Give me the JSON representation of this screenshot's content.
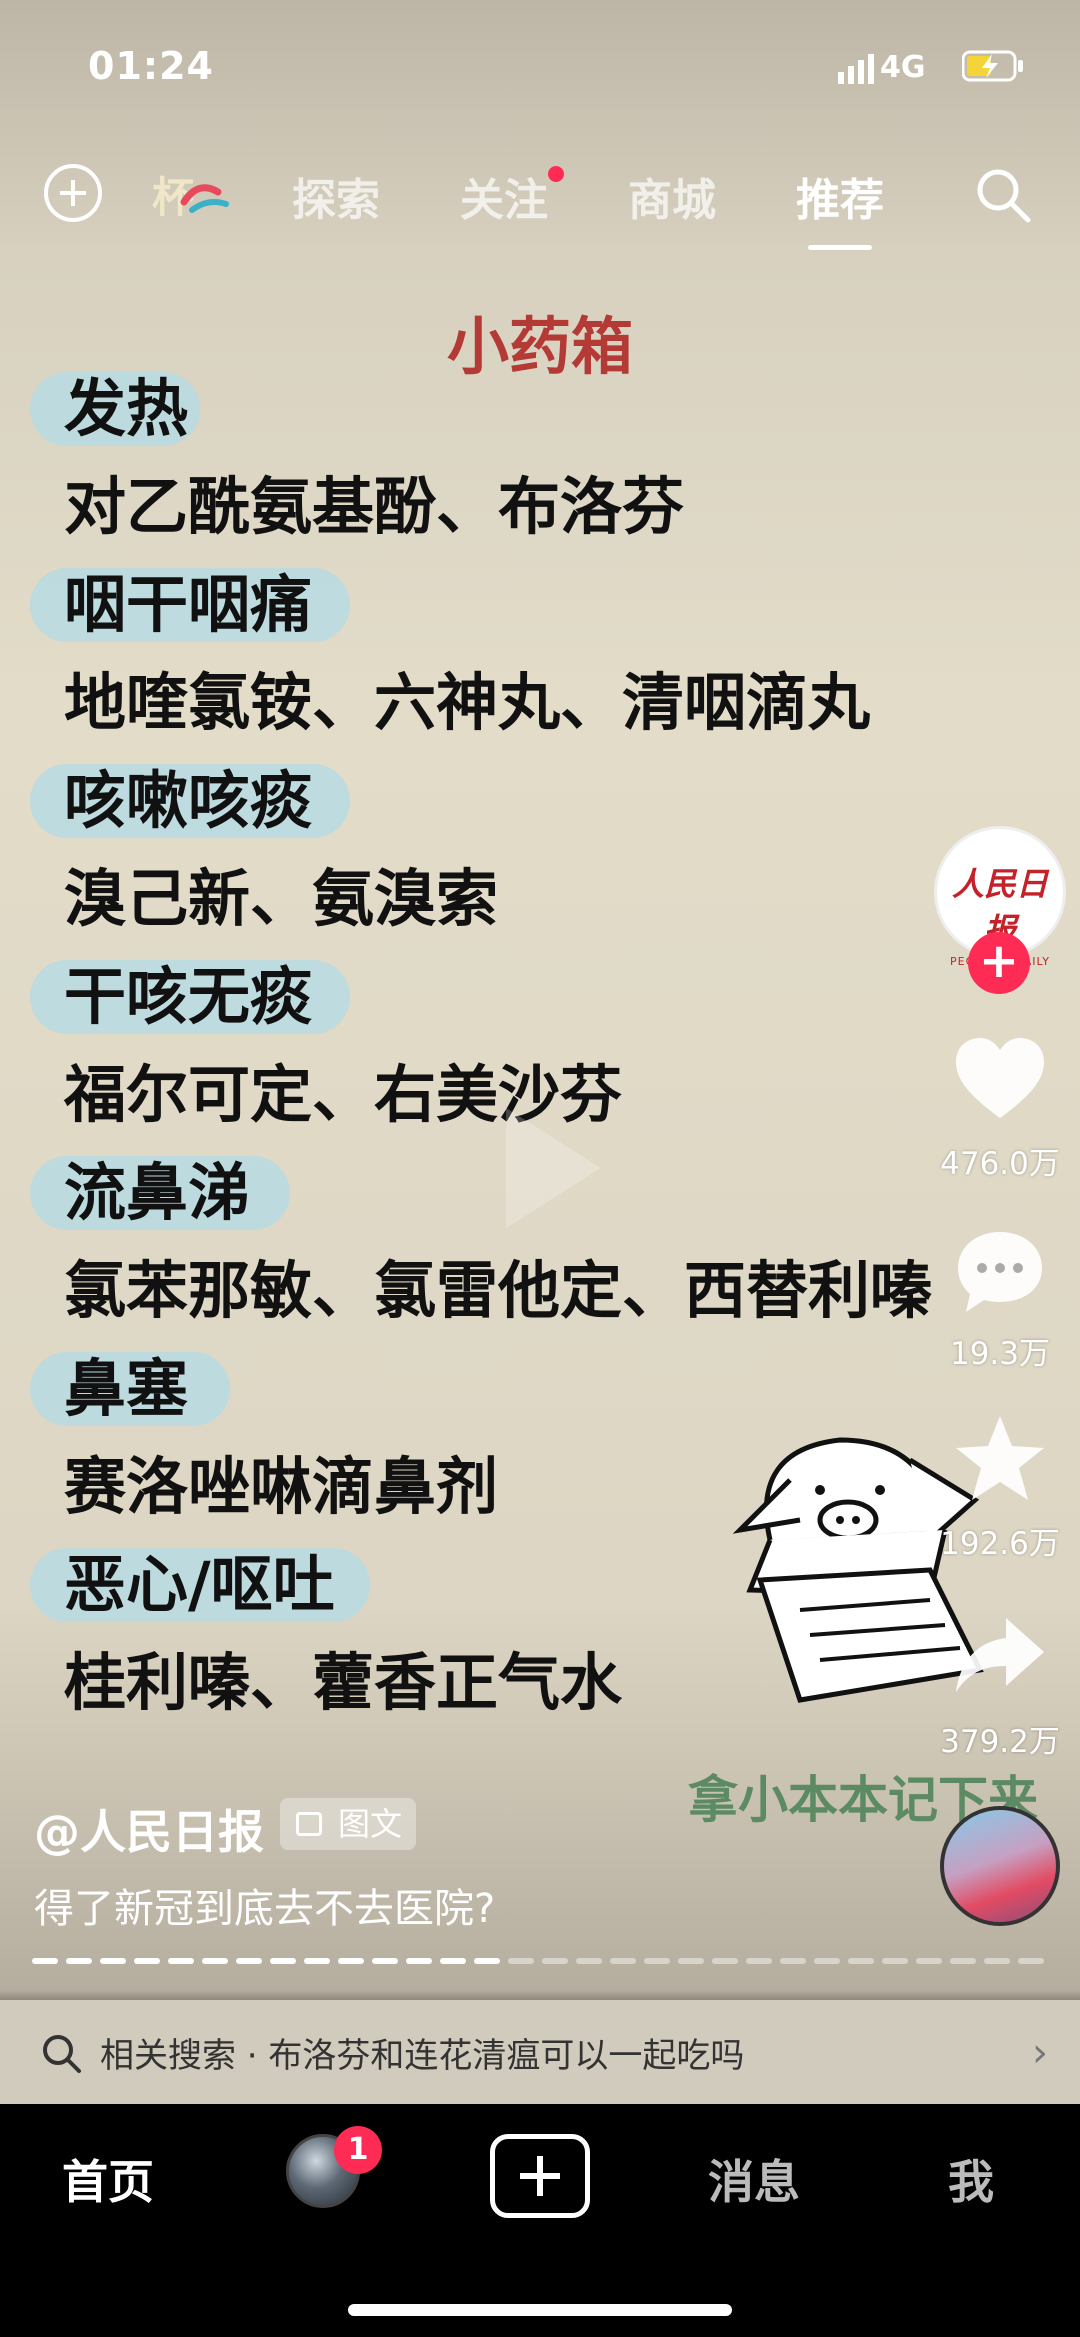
{
  "status_bar": {
    "time": "01:24",
    "network": "4G"
  },
  "top_nav": {
    "left_partial_label": "杯",
    "tabs": [
      {
        "label": "探索",
        "active": false,
        "dot": false
      },
      {
        "label": "关注",
        "active": false,
        "dot": true
      },
      {
        "label": "商城",
        "active": false,
        "dot": false
      },
      {
        "label": "推荐",
        "active": true,
        "dot": false
      }
    ]
  },
  "post": {
    "title": "小药箱",
    "items": [
      {
        "category": "发热",
        "meds": "对乙酰氨基酚、布洛芬"
      },
      {
        "category": "咽干咽痛",
        "meds": "地喹氯铵、六神丸、清咽滴丸"
      },
      {
        "category": "咳嗽咳痰",
        "meds": "溴己新、氨溴索"
      },
      {
        "category": "干咳无痰",
        "meds": "福尔可定、右美沙芬"
      },
      {
        "category": "流鼻涕",
        "meds": "氯苯那敏、氯雷他定、西替利嗪"
      },
      {
        "category": "鼻塞",
        "meds": "赛洛唑啉滴鼻剂"
      },
      {
        "category": "恶心/呕吐",
        "meds": "桂利嗪、藿香正气水"
      }
    ],
    "sticker_text": "拿小本本记下来"
  },
  "rail": {
    "avatar_name_cn": "人民日报",
    "avatar_name_en": "PEOPLE'S DAILY",
    "follow_symbol": "+",
    "likes": "476.0万",
    "comments": "19.3万",
    "favorites": "192.6万",
    "shares": "379.2万"
  },
  "author": {
    "handle": "@人民日报",
    "badge": "图文"
  },
  "caption": "得了新冠到底去不去医院?",
  "related_search": {
    "text": "相关搜索 · 布洛芬和连花清瘟可以一起吃吗"
  },
  "bottom_nav": {
    "home": "首页",
    "friends_badge": "1",
    "messages": "消息",
    "me": "我"
  }
}
